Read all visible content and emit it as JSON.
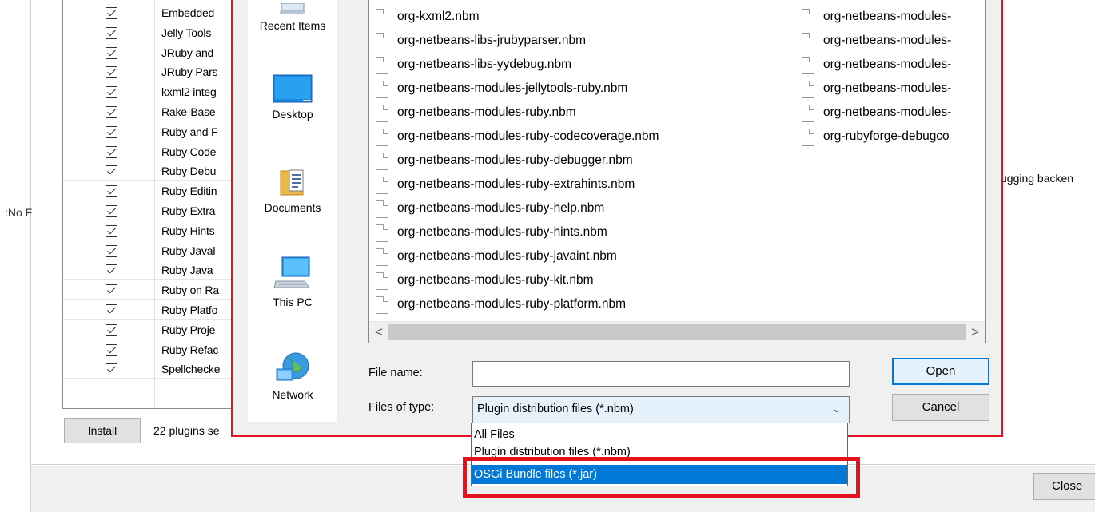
{
  "background": {
    "no_label": ":No F",
    "right_text": "ugging backen",
    "plugins": [
      "Embedded",
      "Jelly Tools",
      "JRuby and",
      "JRuby Pars",
      "kxml2 integ",
      "Rake-Base",
      "Ruby and F",
      "Ruby Code",
      "Ruby Debu",
      "Ruby Editin",
      "Ruby Extra",
      "Ruby Hints",
      "Ruby Javal",
      "Ruby Java",
      "Ruby on Ra",
      "Ruby Platfo",
      "Ruby Proje",
      "Ruby Refac",
      "Spellchecke"
    ],
    "install_label": "Install",
    "plugins_count": "22 plugins se",
    "close_label": "Close"
  },
  "dialog": {
    "places": [
      {
        "label": "Recent Items",
        "icon": "recent-items-icon"
      },
      {
        "label": "Desktop",
        "icon": "desktop-icon"
      },
      {
        "label": "Documents",
        "icon": "documents-icon"
      },
      {
        "label": "This PC",
        "icon": "this-pc-icon"
      },
      {
        "label": "Network",
        "icon": "network-icon"
      }
    ],
    "files_col1": [
      "org-kxml2.nbm",
      "org-netbeans-libs-jrubyparser.nbm",
      "org-netbeans-libs-yydebug.nbm",
      "org-netbeans-modules-jellytools-ruby.nbm",
      "org-netbeans-modules-ruby.nbm",
      "org-netbeans-modules-ruby-codecoverage.nbm",
      "org-netbeans-modules-ruby-debugger.nbm",
      "org-netbeans-modules-ruby-extrahints.nbm",
      "org-netbeans-modules-ruby-help.nbm",
      "org-netbeans-modules-ruby-hints.nbm",
      "org-netbeans-modules-ruby-javaint.nbm",
      "org-netbeans-modules-ruby-kit.nbm",
      "org-netbeans-modules-ruby-platform.nbm"
    ],
    "files_col2": [
      "org-netbeans-modules-",
      "org-netbeans-modules-",
      "org-netbeans-modules-",
      "org-netbeans-modules-",
      "org-netbeans-modules-",
      "org-rubyforge-debugco"
    ],
    "scroll_left": "<",
    "scroll_right": ">",
    "file_name_label": "File name:",
    "file_name_value": "",
    "files_of_type_label": "Files of type:",
    "files_of_type_value": "Plugin distribution files (*.nbm)",
    "open_label": "Open",
    "cancel_label": "Cancel",
    "type_options": [
      "All Files",
      "Plugin distribution files (*.nbm)",
      "OSGi Bundle files (*.jar)"
    ],
    "selected_option_index": 2
  },
  "colors": {
    "accent": "#0078d7",
    "highlight": "#e3121c",
    "dialog_border": "#e81123"
  }
}
